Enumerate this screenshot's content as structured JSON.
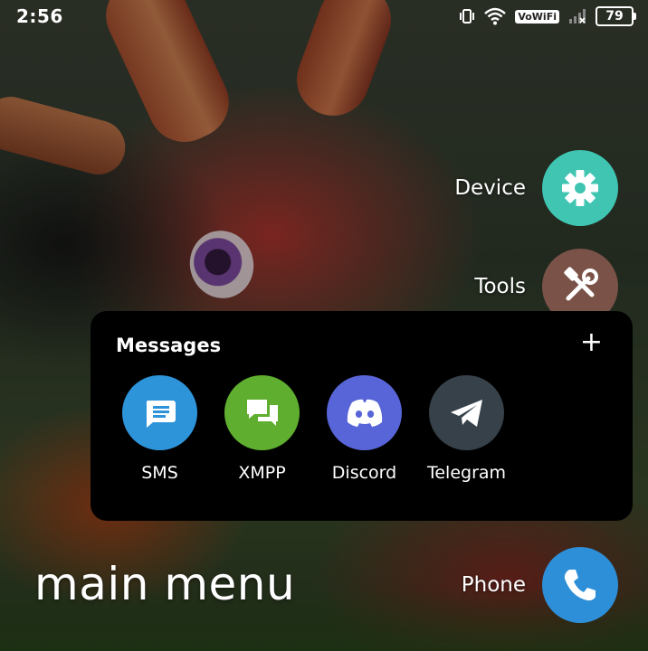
{
  "status_bar": {
    "time": "2:56",
    "vowifi_label": "VoWiFi",
    "battery_level": "79"
  },
  "shortcuts": {
    "device": {
      "label": "Device",
      "color": "#3fc5b2",
      "icon": "gear-icon"
    },
    "tools": {
      "label": "Tools",
      "color": "#7a5247",
      "icon": "tools-icon"
    },
    "phone": {
      "label": "Phone",
      "color": "#2d8fd8",
      "icon": "phone-icon"
    }
  },
  "messages_panel": {
    "title": "Messages",
    "add_symbol": "+",
    "apps": [
      {
        "label": "SMS",
        "color": "#2e94da",
        "icon": "sms-icon"
      },
      {
        "label": "XMPP",
        "color": "#5fae2f",
        "icon": "chat-bubbles-icon"
      },
      {
        "label": "Discord",
        "color": "#5865d8",
        "icon": "discord-icon"
      },
      {
        "label": "Telegram",
        "color": "#37414a",
        "icon": "telegram-icon"
      }
    ]
  },
  "main_title": "main menu"
}
